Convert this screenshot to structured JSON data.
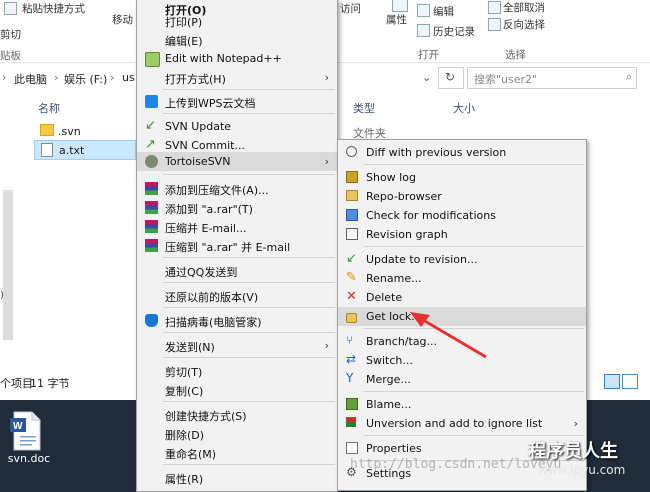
{
  "ribbon": {
    "paste_shortcut": "粘贴快捷方式",
    "move_to": "移动",
    "copy_to": "剪切",
    "clipboard_group": "贴板",
    "access": "访问",
    "properties": "属性",
    "edit": "编辑",
    "history": "历史记录",
    "open_group": "打开",
    "select_all": "全部取消",
    "invert_selection": "反向选择",
    "select_group": "选择"
  },
  "address": {
    "crumbs": [
      "此电脑",
      "娱乐 (F:)",
      "us"
    ],
    "search_placeholder": "搜索\"user2\""
  },
  "columns": {
    "name": "名称",
    "type": "类型",
    "size": "大小"
  },
  "files": [
    {
      "name": ".svn",
      "type": "文件夹",
      "kind": "folder"
    },
    {
      "name": "a.txt",
      "kind": "text",
      "selected": true
    }
  ],
  "status": {
    "items": "个项目",
    "selection_size": "11 字节"
  },
  "desktop": {
    "icon_label": "svn.doc"
  },
  "context_menu": {
    "items": [
      {
        "label": "打开(O)",
        "icon": "none"
      },
      {
        "label": "打印(P)",
        "icon": "none"
      },
      {
        "label": "编辑(E)",
        "icon": "none"
      },
      {
        "label": "Edit with Notepad++",
        "icon": "notepad-icon"
      },
      {
        "label": "打开方式(H)",
        "icon": "none",
        "submenu": true
      },
      {
        "label": "上传到WPS云文档",
        "icon": "wps-cloud-icon"
      },
      {
        "label": "SVN Update",
        "icon": "svn-update-icon"
      },
      {
        "label": "SVN Commit...",
        "icon": "svn-commit-icon"
      },
      {
        "label": "TortoiseSVN",
        "icon": "tortoise-icon",
        "submenu": true
      },
      {
        "label": "添加到压缩文件(A)...",
        "icon": "winrar-icon"
      },
      {
        "label": "添加到 \"a.rar\"(T)",
        "icon": "winrar-icon"
      },
      {
        "label": "压缩并 E-mail...",
        "icon": "winrar-icon"
      },
      {
        "label": "压缩到 \"a.rar\" 并 E-mail",
        "icon": "winrar-icon"
      },
      {
        "label": "通过QQ发送到",
        "icon": "none"
      },
      {
        "label": "还原以前的版本(V)",
        "icon": "none"
      },
      {
        "label": "扫描病毒(电脑管家)",
        "icon": "shield-icon"
      },
      {
        "label": "发送到(N)",
        "icon": "none",
        "submenu": true
      },
      {
        "label": "剪切(T)",
        "icon": "none"
      },
      {
        "label": "复制(C)",
        "icon": "none"
      },
      {
        "label": "创建快捷方式(S)",
        "icon": "none"
      },
      {
        "label": "删除(D)",
        "icon": "none"
      },
      {
        "label": "重命名(M)",
        "icon": "none"
      },
      {
        "label": "属性(R)",
        "icon": "none"
      }
    ]
  },
  "svn_submenu": {
    "items": [
      {
        "label": "Diff with previous version",
        "icon": "diff-icon"
      },
      {
        "label": "Show log",
        "icon": "log-icon"
      },
      {
        "label": "Repo-browser",
        "icon": "repo-browser-icon"
      },
      {
        "label": "Check for modifications",
        "icon": "check-mods-icon"
      },
      {
        "label": "Revision graph",
        "icon": "revision-graph-icon"
      },
      {
        "label": "Update to revision...",
        "icon": "update-revision-icon"
      },
      {
        "label": "Rename...",
        "icon": "rename-icon"
      },
      {
        "label": "Delete",
        "icon": "delete-icon"
      },
      {
        "label": "Get lock...",
        "icon": "lock-icon",
        "highlighted": true
      },
      {
        "label": "Branch/tag...",
        "icon": "branch-icon"
      },
      {
        "label": "Switch...",
        "icon": "switch-icon"
      },
      {
        "label": "Merge...",
        "icon": "merge-icon"
      },
      {
        "label": "Blame...",
        "icon": "blame-icon"
      },
      {
        "label": "Unversion and add to ignore list",
        "icon": "ignore-icon",
        "submenu": true
      },
      {
        "label": "Properties",
        "icon": "properties-icon"
      },
      {
        "label": "Settings",
        "icon": "settings-icon"
      }
    ]
  },
  "watermark": {
    "url": "http://blog.csdn.net/loveyu",
    "brand": "程序员人生",
    "domain": "www.ipyu.com"
  },
  "colors": {
    "selection": "#cce8ff",
    "annotation_arrow": "#e8312f",
    "svn_green": "#2e9a2e",
    "desktop": "#1f2c3a"
  }
}
